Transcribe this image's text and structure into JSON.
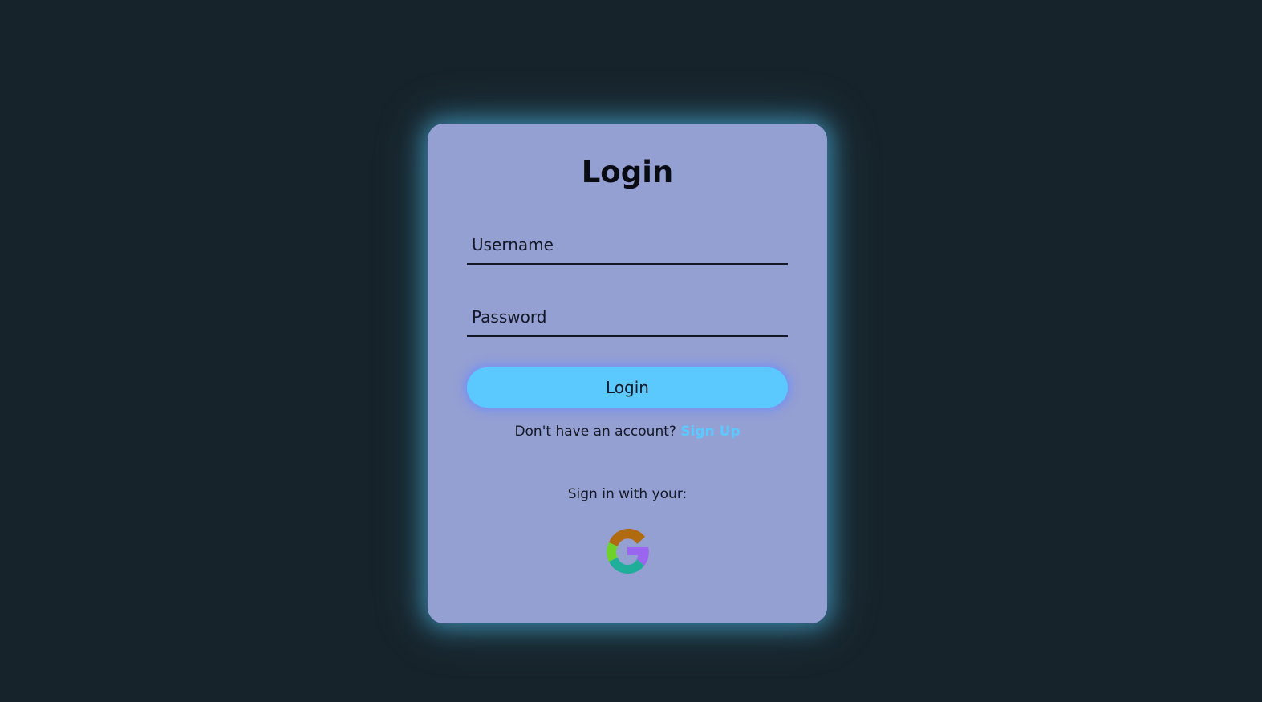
{
  "login_form": {
    "title": "Login",
    "username_placeholder": "Username",
    "password_placeholder": "Password",
    "submit_label": "Login",
    "signup_prompt": "Don't have an account?",
    "signup_link": "Sign Up",
    "social_prompt": "Sign in with your:",
    "social_providers": [
      {
        "name": "google",
        "icon": "google-icon"
      }
    ]
  },
  "colors": {
    "page_background": "#17232a",
    "card_background": "#949fd2",
    "card_glow": "#4fbeec",
    "button_background": "#5bc8fe",
    "button_glow": "#6c8cff",
    "link": "#5bc8fe",
    "text": "#141824"
  }
}
